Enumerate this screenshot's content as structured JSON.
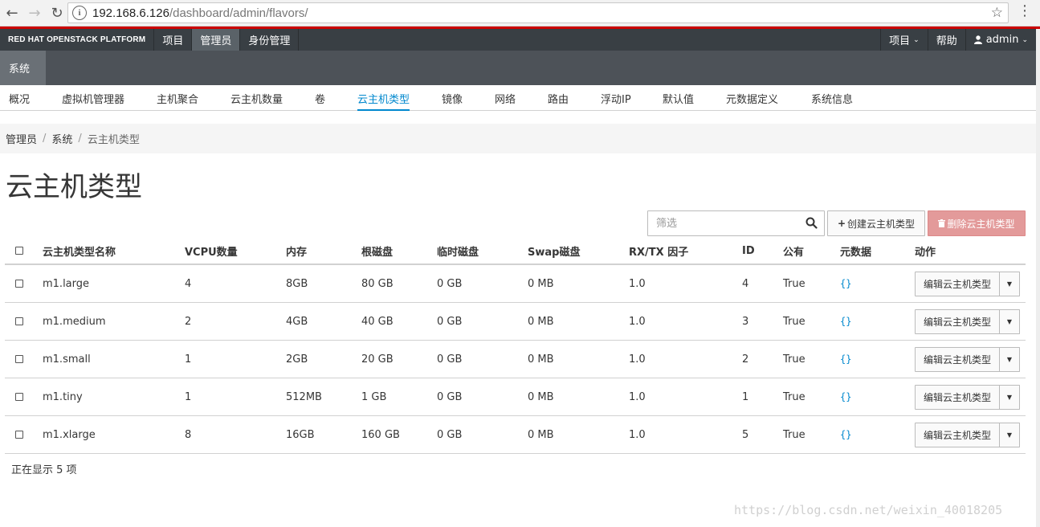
{
  "browser": {
    "back_icon": "arrow-left-icon",
    "forward_icon": "arrow-right-icon",
    "reload_icon": "reload-icon",
    "url_host": "192.168.6.126",
    "url_path": "/dashboard/admin/flavors/",
    "bookmark_icon": "star-icon",
    "menu_icon": "vertical-dots-icon"
  },
  "topbar": {
    "brand": "RED HAT OPENSTACK PLATFORM",
    "nav": [
      "项目",
      "管理员",
      "身份管理"
    ],
    "project_menu": "项目",
    "help": "帮助",
    "user": "admin",
    "accent_color": "#cc0000"
  },
  "secondary": {
    "tab": "系统"
  },
  "tertiary": [
    "概况",
    "虚拟机管理器",
    "主机聚合",
    "云主机数量",
    "卷",
    "云主机类型",
    "镜像",
    "网络",
    "路由",
    "浮动IP",
    "默认值",
    "元数据定义",
    "系统信息"
  ],
  "breadcrumb": [
    "管理员",
    "系统",
    "云主机类型"
  ],
  "page_title": "云主机类型",
  "filter": {
    "placeholder": "筛选"
  },
  "buttons": {
    "create": "创建云主机类型",
    "delete": "删除云主机类型"
  },
  "table": {
    "headers": [
      "云主机类型名称",
      "VCPU数量",
      "内存",
      "根磁盘",
      "临时磁盘",
      "Swap磁盘",
      "RX/TX 因子",
      "ID",
      "公有",
      "元数据",
      "动作"
    ],
    "rows": [
      {
        "name": "m1.large",
        "vcpu": "4",
        "ram": "8GB",
        "root": "80 GB",
        "ephemeral": "0 GB",
        "swap": "0 MB",
        "rxtx": "1.0",
        "id": "4",
        "public": "True",
        "meta": "{}"
      },
      {
        "name": "m1.medium",
        "vcpu": "2",
        "ram": "4GB",
        "root": "40 GB",
        "ephemeral": "0 GB",
        "swap": "0 MB",
        "rxtx": "1.0",
        "id": "3",
        "public": "True",
        "meta": "{}"
      },
      {
        "name": "m1.small",
        "vcpu": "1",
        "ram": "2GB",
        "root": "20 GB",
        "ephemeral": "0 GB",
        "swap": "0 MB",
        "rxtx": "1.0",
        "id": "2",
        "public": "True",
        "meta": "{}"
      },
      {
        "name": "m1.tiny",
        "vcpu": "1",
        "ram": "512MB",
        "root": "1 GB",
        "ephemeral": "0 GB",
        "swap": "0 MB",
        "rxtx": "1.0",
        "id": "1",
        "public": "True",
        "meta": "{}"
      },
      {
        "name": "m1.xlarge",
        "vcpu": "8",
        "ram": "16GB",
        "root": "160 GB",
        "ephemeral": "0 GB",
        "swap": "0 MB",
        "rxtx": "1.0",
        "id": "5",
        "public": "True",
        "meta": "{}"
      }
    ],
    "edit_action": "编辑云主机类型"
  },
  "footer": {
    "count_text": "正在显示 5 项"
  },
  "watermark": "https://blog.csdn.net/weixin_40018205"
}
